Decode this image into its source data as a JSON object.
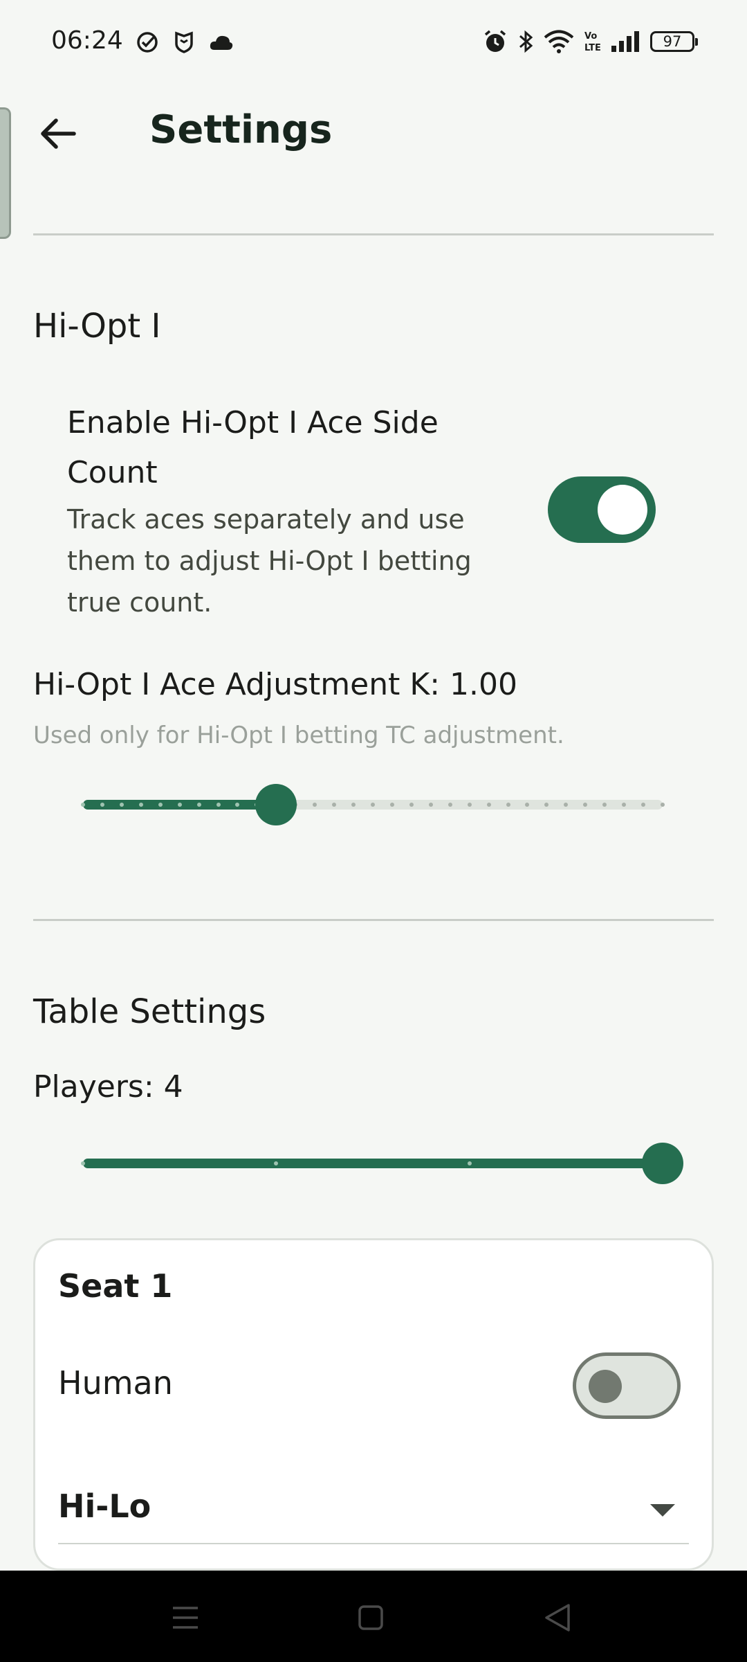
{
  "status_bar": {
    "time": "06:24",
    "battery": "97",
    "left_icons": [
      "check-circle-icon",
      "shield-icon",
      "cloud-icon"
    ],
    "right_icons": [
      "alarm-icon",
      "bluetooth-icon",
      "wifi-icon",
      "volte-icon",
      "signal-icon",
      "battery-icon"
    ]
  },
  "app_bar": {
    "title": "Settings",
    "back_icon": "arrow-back-icon"
  },
  "hi_opt": {
    "section_title": "Hi-Opt I",
    "ace_side_count": {
      "title": "Enable Hi-Opt I Ace Side Count",
      "description": "Track aces separately and use them to adjust Hi-Opt I betting true count.",
      "enabled": true
    },
    "ace_adjustment": {
      "label": "Hi-Opt I Ace Adjustment K: 1.00",
      "hint": "Used only for Hi-Opt I betting TC adjustment.",
      "value_fraction": 0.333,
      "steps": 30
    }
  },
  "table_settings": {
    "section_title": "Table Settings",
    "players_label": "Players: 4",
    "players_value": 4,
    "players_min": 1,
    "players_max": 4
  },
  "seat": {
    "title": "Seat 1",
    "human_label": "Human",
    "human_enabled": false,
    "count_system": "Hi-Lo"
  },
  "colors": {
    "accent": "#256e50",
    "background": "#f5f7f4",
    "track_inactive": "#dfe4de"
  },
  "nav_bar": {
    "buttons": [
      "menu-icon",
      "home-icon",
      "back-triangle-icon"
    ]
  }
}
